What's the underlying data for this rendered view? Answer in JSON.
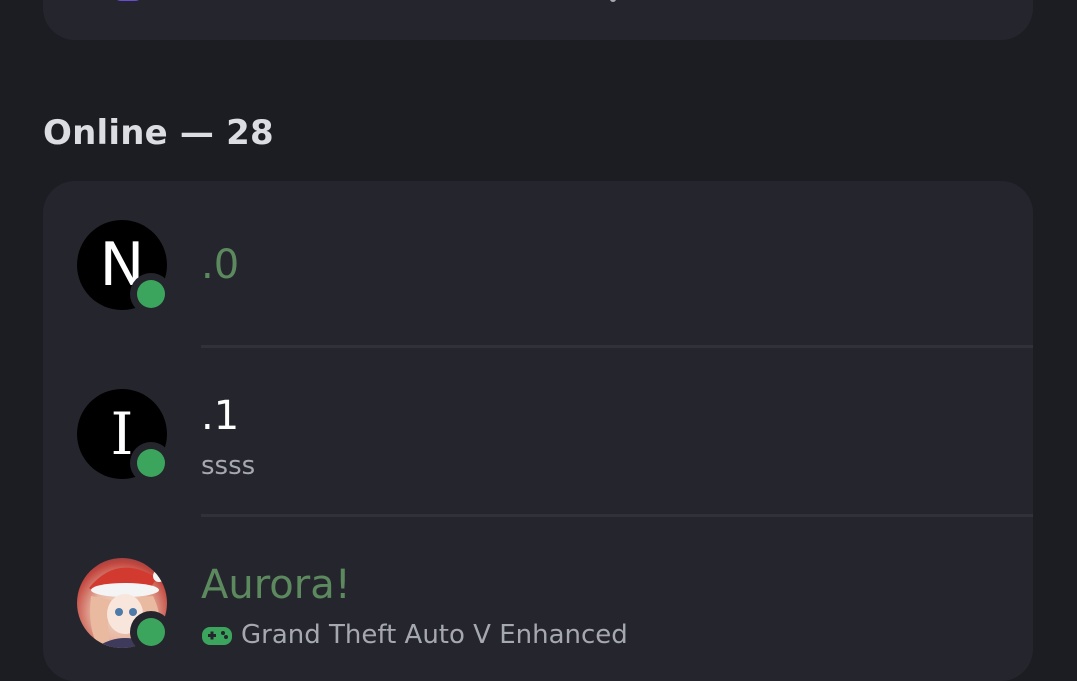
{
  "section": {
    "title": "Online — 28"
  },
  "members": [
    {
      "avatar_letter": "N",
      "name": ".0",
      "name_color": "#5c8a5e",
      "status": "online",
      "subtitle": ""
    },
    {
      "avatar_letter": "I",
      "name": ".1",
      "name_color": "#ffffff",
      "status": "online",
      "subtitle": "ssss"
    },
    {
      "avatar_letter": "",
      "name": "Aurora!",
      "name_color": "#5c8a5e",
      "status": "online",
      "subtitle": "Grand Theft Auto V Enhanced",
      "subtitle_icon": "gamepad-icon"
    }
  ],
  "colors": {
    "background": "#1c1d22",
    "card": "#25262d",
    "online": "#3ba55d",
    "role_green": "#5c8a5e"
  }
}
